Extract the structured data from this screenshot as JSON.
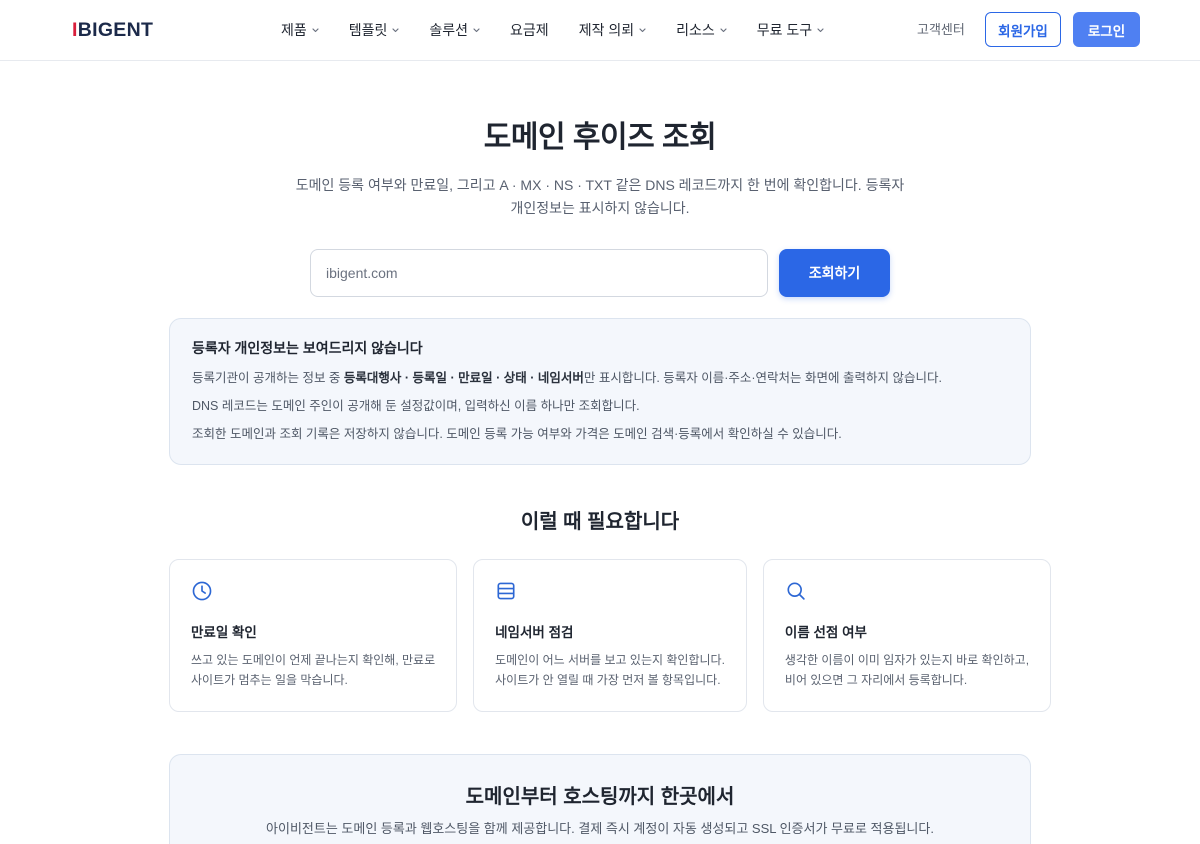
{
  "header": {
    "logo": "IBIGENT",
    "nav": [
      {
        "label": "제품",
        "has_dropdown": true
      },
      {
        "label": "템플릿",
        "has_dropdown": true
      },
      {
        "label": "솔루션",
        "has_dropdown": true
      },
      {
        "label": "요금제",
        "has_dropdown": false
      },
      {
        "label": "제작 의뢰",
        "has_dropdown": true
      },
      {
        "label": "리소스",
        "has_dropdown": true
      },
      {
        "label": "무료 도구",
        "has_dropdown": true
      }
    ],
    "support_link": "고객센터",
    "signup_label": "회원가입",
    "login_label": "로그인"
  },
  "hero": {
    "title": "도메인 후이즈 조회",
    "subtitle_lines": [
      "도메인 등록 여부와 만료일, 그리고 A · MX · NS · TXT 같은 DNS 레코드까지 한 번에 확인합니다. 등록자",
      "개인정보는 표시하지 않습니다."
    ]
  },
  "search": {
    "placeholder": "ibigent.com",
    "button_label": "조회하기"
  },
  "privacy_notice": {
    "title": "등록자 개인정보는 보여드리지 않습니다",
    "line1": {
      "before": "등록기관이 공개하는 정보 중 ",
      "bold": "등록대행사 · 등록일 · 만료일 · 상태 · 네임서버",
      "after": "만 표시합니다. 등록자 이름·주소·연락처는 화면에 출력하지 않습니다."
    },
    "line2": "DNS 레코드는 도메인 주인이 공개해 둔 설정값이며, 입력하신 이름 하나만 조회합니다.",
    "line3": "조회한 도메인과 조회 기록은 저장하지 않습니다. 도메인 등록 가능 여부와 가격은 도메인 검색·등록에서 확인하실 수 있습니다."
  },
  "use_cases": {
    "heading": "이럴 때 필요합니다",
    "cards": [
      {
        "icon": "clock-icon",
        "title": "만료일 확인",
        "desc_lines": [
          "쓰고 있는 도메인이 언제 끝나는지 확인해, 만료로",
          "사이트가 멈추는 일을 막습니다."
        ]
      },
      {
        "icon": "server-icon",
        "title": "네임서버 점검",
        "desc_lines": [
          "도메인이 어느 서버를 보고 있는지 확인합니다.",
          "사이트가 안 열릴 때 가장 먼저 볼 항목입니다."
        ]
      },
      {
        "icon": "search-icon",
        "title": "이름 선점 여부",
        "desc_lines": [
          "생각한 이름이 이미 임자가 있는지 바로 확인하고,",
          "비어 있으면 그 자리에서 등록합니다."
        ]
      }
    ]
  },
  "promo": {
    "heading": "도메인부터 호스팅까지 한곳에서",
    "text": "아이비전트는 도메인 등록과 웹호스팅을 함께 제공합니다. 결제 즉시 계정이 자동 생성되고 SSL 인증서가 무료로 적용됩니다."
  },
  "colors": {
    "primary": "#2b67e6",
    "login_button": "#4f80f2",
    "brand_navy": "#1c2a4a",
    "brand_red": "#d81e3b",
    "icon": "#2d67d4",
    "panel_bg": "#f4f7fc"
  }
}
